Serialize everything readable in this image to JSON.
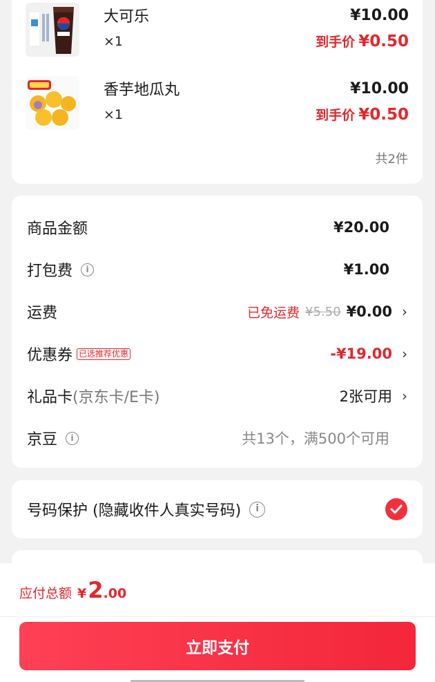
{
  "products": [
    {
      "name": "大可乐",
      "qty": "×1",
      "price": "¥10.00",
      "final_label": "到手价",
      "final_price": "¥0.50",
      "icon": "cola-cup-image"
    },
    {
      "name": "香芋地瓜丸",
      "qty": "×1",
      "price": "¥10.00",
      "final_label": "到手价",
      "final_price": "¥0.50",
      "icon": "taro-balls-image"
    }
  ],
  "product_count": "共2件",
  "fees": {
    "goods": {
      "label": "商品金额",
      "value": "¥20.00"
    },
    "packing": {
      "label": "打包费",
      "value": "¥1.00"
    },
    "shipping": {
      "label": "运费",
      "free_text": "已免运费",
      "original": "¥5.50",
      "value": "¥0.00"
    },
    "coupon": {
      "label": "优惠券",
      "tag": "已选推荐优惠",
      "value": "-¥19.00"
    },
    "giftcard": {
      "label": "礼品卡",
      "sub": "(京东卡/E卡)",
      "value": "2张可用"
    },
    "beans": {
      "label": "京豆",
      "value": "共13个，满500个可用"
    }
  },
  "privacy": {
    "label": "号码保护 (隐藏收件人真实号码)",
    "checked": true
  },
  "total": {
    "label": "应付总额",
    "currency": "¥",
    "integer": "2",
    "decimal": ".00"
  },
  "pay_button": "立即支付",
  "colors": {
    "accent": "#e4262b",
    "pay_gradient_start": "#ff4055",
    "pay_gradient_end": "#f3263a"
  }
}
